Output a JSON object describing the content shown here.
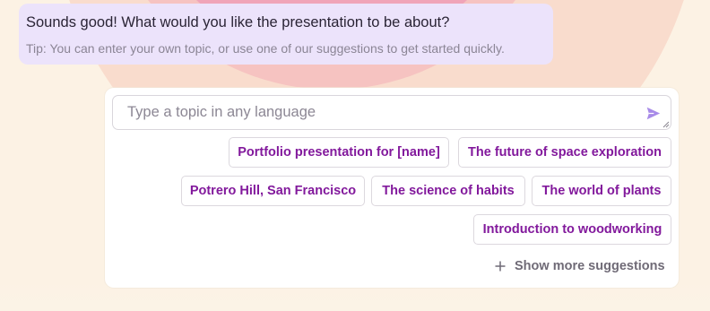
{
  "chat": {
    "question": "Sounds good! What would you like the presentation to be about?",
    "tip": "Tip: You can enter your own topic, or use one of our suggestions to get started quickly."
  },
  "topic_input": {
    "placeholder": "Type a topic in any language",
    "value": ""
  },
  "suggestions": [
    {
      "label": "Portfolio presentation for [name]"
    },
    {
      "label": "The future of space exploration"
    },
    {
      "label": "Potrero Hill, San Francisco"
    },
    {
      "label": "The science of habits"
    },
    {
      "label": "The world of plants"
    },
    {
      "label": "Introduction to woodworking"
    }
  ],
  "show_more_label": "Show more suggestions",
  "icons": {
    "send": "send-icon",
    "plus": "plus-icon",
    "resize": "resize-handle-icon"
  },
  "colors": {
    "accent": "#82199c",
    "send_icon": "#a88be8",
    "bubble_bg": "#ece3fb"
  }
}
